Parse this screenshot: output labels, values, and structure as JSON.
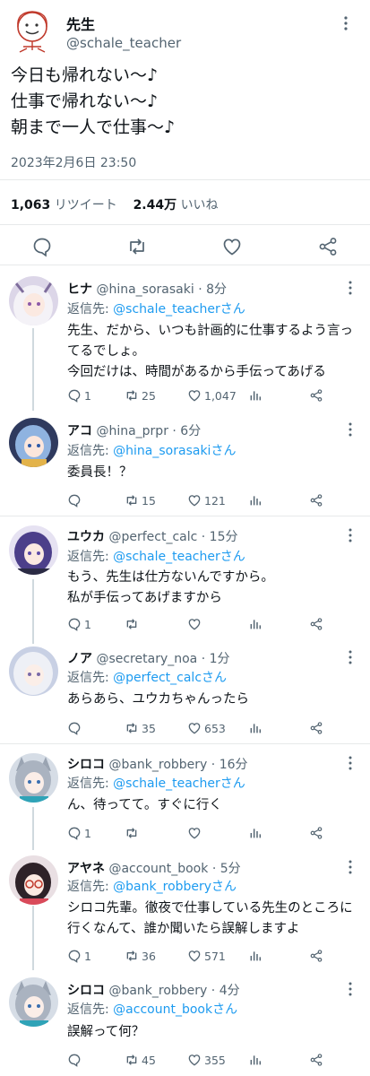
{
  "main_tweet": {
    "author_name": "先生",
    "author_handle": "@schale_teacher",
    "text_lines": [
      "今日も帰れない～♪",
      "仕事で帰れない～♪",
      "朝まで一人で仕事～♪"
    ],
    "timestamp": "2023年2月6日 23:50",
    "retweet_count": "1,063",
    "retweet_label": "リツイート",
    "like_count": "2.44万",
    "like_label": "いいね"
  },
  "replies": [
    {
      "name": "ヒナ",
      "handle": "@hina_sorasaki",
      "time": "· 8分",
      "reply_prefix": "返信先: ",
      "reply_to": "@schale_teacherさん",
      "text_lines": [
        "先生、だから、いつも計画的に仕事するよう言っ",
        "てるでしょ。",
        "今回だけは、時間があるから手伝ってあげる"
      ],
      "reply_count": "1",
      "retweet_count": "25",
      "like_count": "1,047",
      "avatar_color": "#c9c3d8"
    },
    {
      "name": "アコ",
      "handle": "@hina_prpr",
      "time": "· 6分",
      "reply_prefix": "返信先: ",
      "reply_to": "@hina_sorasakiさん",
      "text_lines": [
        "委員長！？"
      ],
      "reply_count": "",
      "retweet_count": "15",
      "like_count": "121",
      "avatar_color": "#3e4a6e"
    },
    {
      "name": "ユウカ",
      "handle": "@perfect_calc",
      "time": "· 15分",
      "reply_prefix": "返信先: ",
      "reply_to": "@schale_teacherさん",
      "text_lines": [
        "もう、先生は仕方ないんですから。",
        "私が手伝ってあげますから"
      ],
      "reply_count": "1",
      "retweet_count": "",
      "like_count": "",
      "avatar_color": "#4d4d86"
    },
    {
      "name": "ノア",
      "handle": "@secretary_noa",
      "time": "· 1分",
      "reply_prefix": "返信先: ",
      "reply_to": "@perfect_calcさん",
      "text_lines": [
        "あらあら、ユウカちゃんったら"
      ],
      "reply_count": "",
      "retweet_count": "35",
      "like_count": "653",
      "avatar_color": "#cfd6e6"
    },
    {
      "name": "シロコ",
      "handle": "@bank_robbery",
      "time": "· 16分",
      "reply_prefix": "返信先: ",
      "reply_to": "@schale_teacherさん",
      "text_lines": [
        "ん、待ってて。すぐに行く"
      ],
      "reply_count": "1",
      "retweet_count": "",
      "like_count": "",
      "avatar_color": "#b7c0cc"
    },
    {
      "name": "アヤネ",
      "handle": "@account_book",
      "time": "· 5分",
      "reply_prefix": "返信先: ",
      "reply_to": "@bank_robberyさん",
      "text_lines": [
        "シロコ先輩。徹夜で仕事している先生のところに",
        "行くなんて、誰か聞いたら誤解しますよ"
      ],
      "reply_count": "1",
      "retweet_count": "36",
      "like_count": "571",
      "avatar_color": "#3b2f33"
    },
    {
      "name": "シロコ",
      "handle": "@bank_robbery",
      "time": "· 4分",
      "reply_prefix": "返信先: ",
      "reply_to": "@account_bookさん",
      "text_lines": [
        "誤解って何？"
      ],
      "reply_count": "",
      "retweet_count": "45",
      "like_count": "355",
      "avatar_color": "#b7c0cc"
    }
  ],
  "colors": {
    "accent": "#1d9bf0",
    "secondary_text": "#536471",
    "divider": "#e7e9ea",
    "thread_line": "#cfd9de"
  }
}
